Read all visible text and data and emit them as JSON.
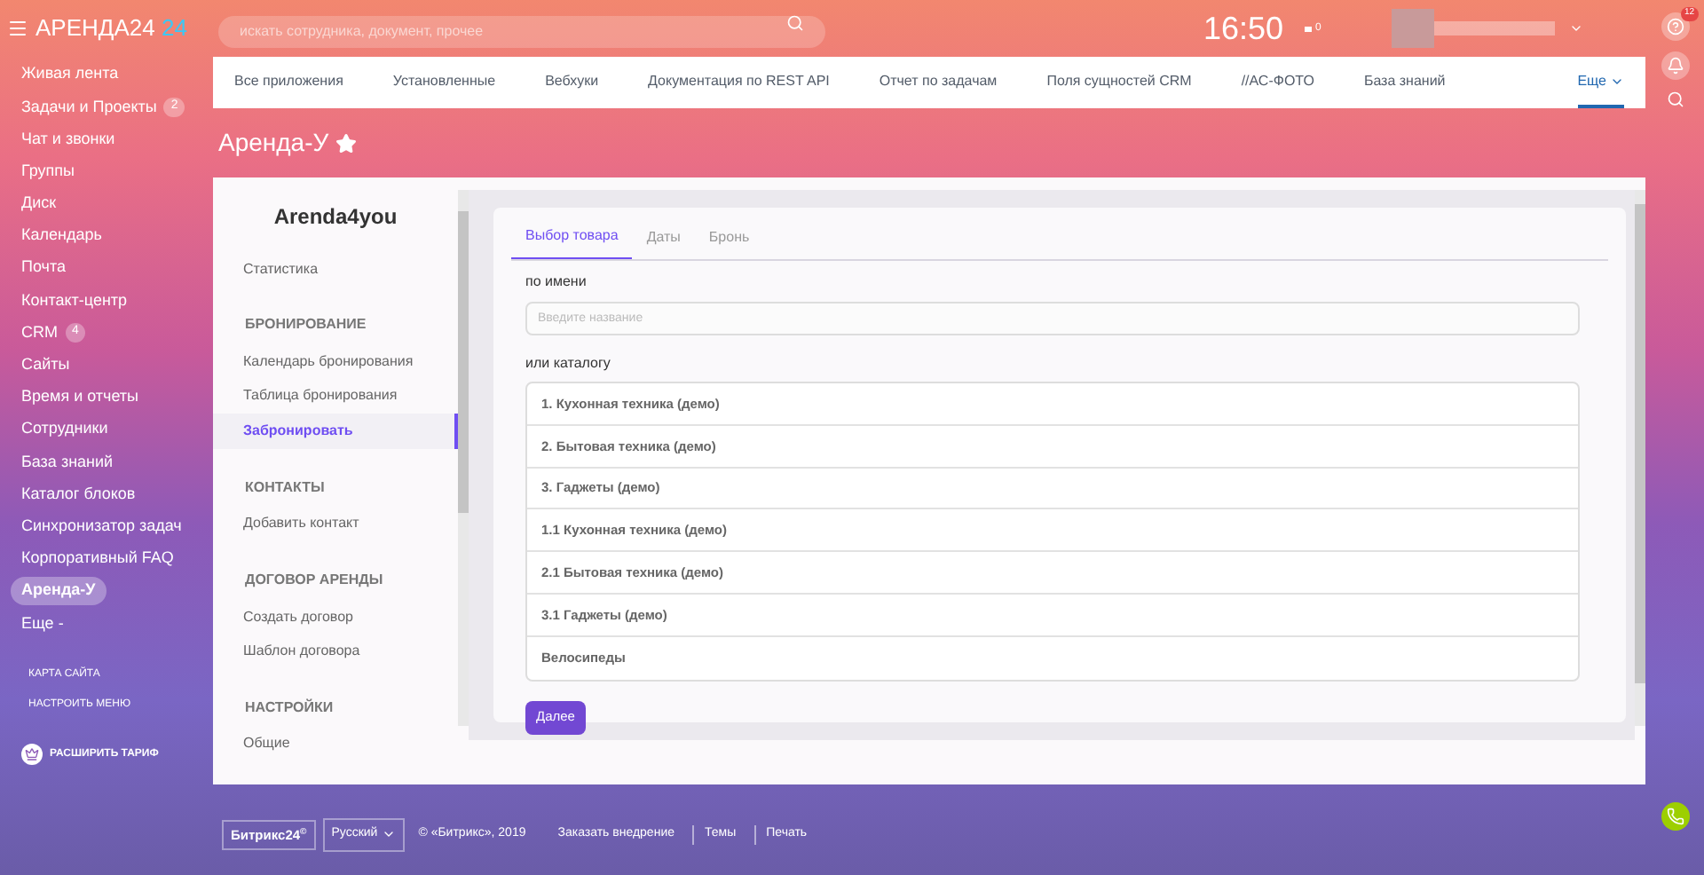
{
  "logo": {
    "name": "АРЕНДА24",
    "suffix": "24"
  },
  "search": {
    "placeholder": "искать сотрудника, документ, прочее"
  },
  "clock": "16:50",
  "status": "0",
  "help_badge": "12",
  "sidebar": {
    "items": [
      {
        "label": "Живая лента",
        "selected": false
      },
      {
        "label": "Задачи и Проекты",
        "counter": "2",
        "selected": false
      },
      {
        "label": "Чат и звонки",
        "selected": false
      },
      {
        "label": "Группы",
        "selected": false
      },
      {
        "label": "Диск",
        "selected": false
      },
      {
        "label": "Календарь",
        "selected": false
      },
      {
        "label": "Почта",
        "selected": false
      },
      {
        "label": "Контакт-центр",
        "selected": false
      },
      {
        "label": "CRM",
        "counter": "4",
        "selected": false
      },
      {
        "label": "Сайты",
        "selected": false
      },
      {
        "label": "Время и отчеты",
        "selected": false
      },
      {
        "label": "Сотрудники",
        "selected": false
      },
      {
        "label": "База знаний",
        "selected": false
      },
      {
        "label": "Каталог блоков",
        "selected": false
      },
      {
        "label": "Синхронизатор задач",
        "selected": false
      },
      {
        "label": "Корпоративный FAQ",
        "selected": false
      },
      {
        "label": "Аренда-У",
        "selected": true
      },
      {
        "label": "Еще -",
        "selected": false
      }
    ],
    "links": [
      "КАРТА САЙТА",
      "НАСТРОИТЬ МЕНЮ"
    ],
    "upgrade": "РАСШИРИТЬ ТАРИФ"
  },
  "top_tabs": [
    {
      "label": "Все приложения",
      "selected": false
    },
    {
      "label": "Установленные",
      "selected": false
    },
    {
      "label": "Вебхуки",
      "selected": false
    },
    {
      "label": "Документация по REST API",
      "selected": false
    },
    {
      "label": "Отчет по задачам",
      "selected": false
    },
    {
      "label": "Поля сущностей CRM",
      "selected": false
    },
    {
      "label": "//АС-ФОТО",
      "selected": false
    },
    {
      "label": "База знаний",
      "selected": false
    },
    {
      "label": "Еще",
      "selected": true
    }
  ],
  "page_title": "Аренда-У",
  "app": {
    "title": "Arenda4you",
    "menu": [
      {
        "kind": "item",
        "label": "Статистика",
        "selected": false
      },
      {
        "kind": "heading",
        "label": "БРОНИРОВАНИЕ"
      },
      {
        "kind": "item",
        "label": "Календарь бронирования",
        "selected": false
      },
      {
        "kind": "item",
        "label": "Таблица бронирования",
        "selected": false
      },
      {
        "kind": "item",
        "label": "Забронировать",
        "selected": true
      },
      {
        "kind": "heading",
        "label": "КОНТАКТЫ"
      },
      {
        "kind": "item",
        "label": "Добавить контакт",
        "selected": false
      },
      {
        "kind": "heading",
        "label": "ДОГОВОР АРЕНДЫ"
      },
      {
        "kind": "item",
        "label": "Создать договор",
        "selected": false
      },
      {
        "kind": "item",
        "label": "Шаблон договора",
        "selected": false
      },
      {
        "kind": "heading",
        "label": "НАСТРОЙКИ"
      },
      {
        "kind": "item",
        "label": "Общие",
        "selected": false
      }
    ],
    "tabs": [
      {
        "label": "Выбор товара",
        "selected": true
      },
      {
        "label": "Даты",
        "selected": false
      },
      {
        "label": "Бронь",
        "selected": false
      }
    ],
    "name_label": "по имени",
    "name_field": {
      "placeholder": "Введите название"
    },
    "catalog_label": "или каталогу",
    "catalog": [
      "1. Кухонная техника (демо)",
      "2. Бытовая техника (демо)",
      "3. Гаджеты (демо)",
      "1.1 Кухонная техника (демо)",
      "2.1 Бытовая техника (демо)",
      "3.1 Гаджеты (демо)",
      "Велосипеды"
    ],
    "next_button": "Далее"
  },
  "footer": {
    "brand": "Битрикс24",
    "brand_mark": "©",
    "language": "Русский",
    "copyright": "© «Битрикс», 2019",
    "links": [
      "Заказать внедрение",
      "Темы",
      "Печать"
    ]
  }
}
